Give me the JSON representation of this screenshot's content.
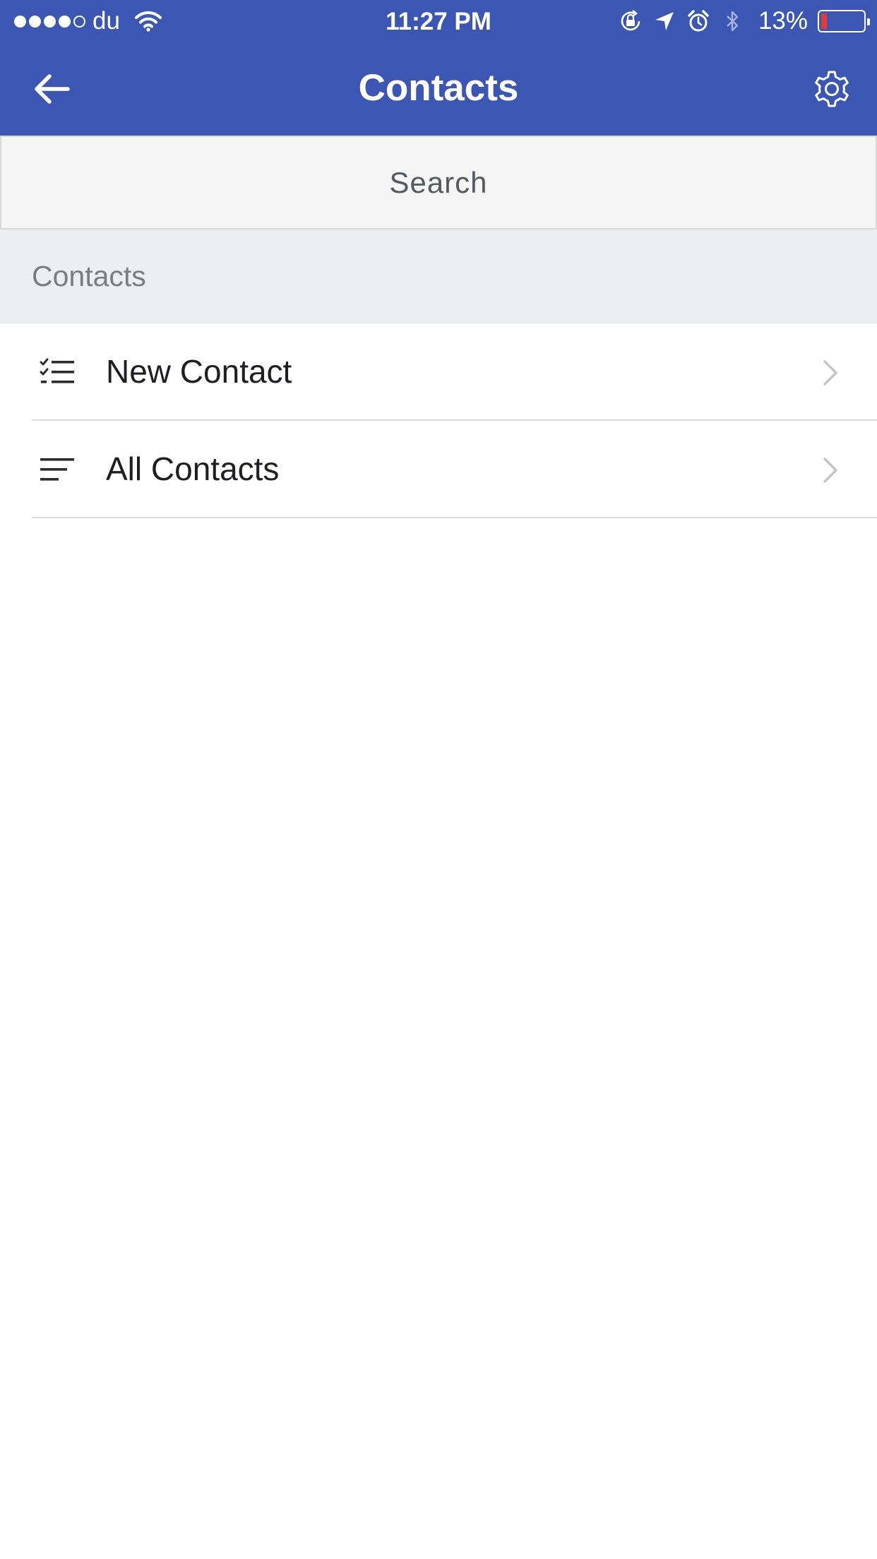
{
  "theme": {
    "accent": "#3c57b3",
    "battery_low": "#e53935"
  },
  "status_bar": {
    "carrier": "du",
    "time": "11:27 PM",
    "battery_percent": "13%",
    "battery_level": 0.13,
    "signal_bars_filled": 4,
    "signal_bars_total": 5,
    "icons": [
      "wifi-icon",
      "orientation-lock-icon",
      "location-icon",
      "alarm-icon",
      "bluetooth-icon",
      "battery-icon"
    ]
  },
  "nav": {
    "title": "Contacts",
    "back_icon": "arrow-left-icon",
    "settings_icon": "gear-icon"
  },
  "search": {
    "label": "Search"
  },
  "section": {
    "title": "Contacts"
  },
  "list": {
    "items": [
      {
        "label": "New Contact",
        "icon": "checklist-icon"
      },
      {
        "label": "All Contacts",
        "icon": "sort-lines-icon"
      }
    ]
  }
}
